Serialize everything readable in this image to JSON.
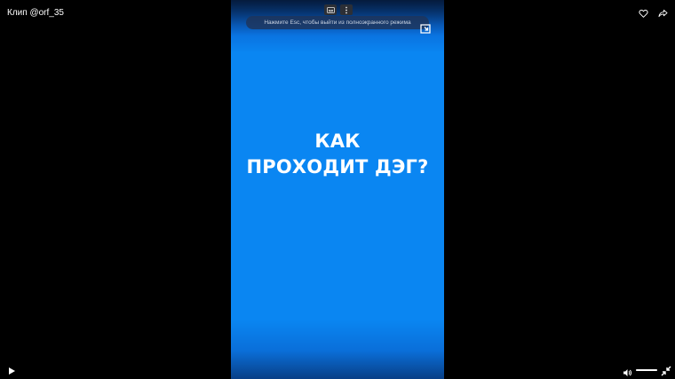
{
  "header": {
    "clip_title": "Клип @orf_35"
  },
  "overlay": {
    "esc_hint": "Нажмите Esc, чтобы выйти из полноэкранного режима"
  },
  "video": {
    "title_line1": "КАК",
    "title_line2": "ПРОХОДИТ ДЭГ?",
    "background_color": "#0a86f2"
  },
  "controls": {
    "volume_level": 1.0
  },
  "icons": {
    "like": "heart-icon",
    "share": "share-arrow-icon",
    "pip": "picture-in-picture-icon",
    "play": "play-icon",
    "volume": "volume-icon",
    "fullscreen": "exit-fullscreen-icon",
    "toolbar_a": "subtitles-icon",
    "toolbar_b": "more-vertical-icon"
  }
}
